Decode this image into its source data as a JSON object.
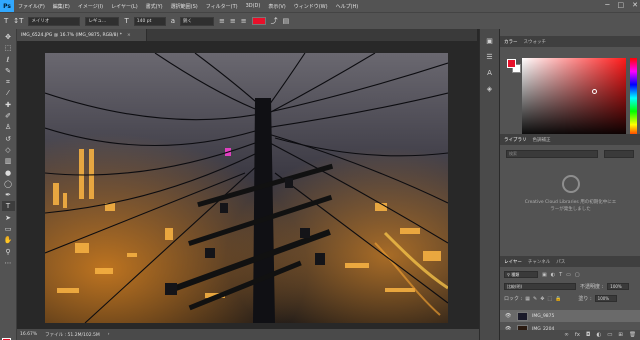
{
  "app": {
    "logo": "Ps"
  },
  "menu": [
    "ファイル(F)",
    "編集(E)",
    "イメージ(I)",
    "レイヤー(L)",
    "書式(Y)",
    "選択範囲(S)",
    "フィルター(T)",
    "3D(D)",
    "表示(V)",
    "ウィンドウ(W)",
    "ヘルプ(H)"
  ],
  "window_controls": {
    "minimize": "─",
    "maximize": "□",
    "close": "✕"
  },
  "options_bar": {
    "font_family": "メイリオ",
    "font_style": "レギュ...",
    "font_size": "140 pt",
    "antialias": "鋭く",
    "text_color": "#e8102a"
  },
  "document": {
    "tab_title": "IMG_6524.JPG @ 16.7% (IMG_9875, RGB/8) *",
    "tab_close": "×"
  },
  "status": {
    "zoom": "16.67%",
    "file_info": "ファイル : 51.2M/102.5M"
  },
  "color_panel": {
    "tabs": [
      "カラー",
      "スウォッチ"
    ],
    "foreground": "#e8102a",
    "background": "#ffffff"
  },
  "libraries_panel": {
    "tabs": [
      "ライブラリ",
      "色調補正"
    ],
    "search_placeholder": "検索",
    "message_line1": "Creative Cloud Libraries 用の初期化中にエ",
    "message_line2": "ラーが発生しました"
  },
  "layers_panel": {
    "tabs": [
      "レイヤー",
      "チャンネル",
      "パス"
    ],
    "kind_filter": "種類",
    "blend_mode": "比較(明)",
    "opacity_label": "不透明度 :",
    "opacity_value": "100%",
    "lock_label": "ロック :",
    "fill_label": "塗り :",
    "fill_value": "100%",
    "layers": [
      {
        "name": "IMG_9875",
        "selected": true
      },
      {
        "name": "IMG_2204",
        "selected": false
      }
    ]
  },
  "colors": {
    "accent": "#31a8ff",
    "ui_bg": "#535353",
    "dark_bg": "#282828"
  }
}
